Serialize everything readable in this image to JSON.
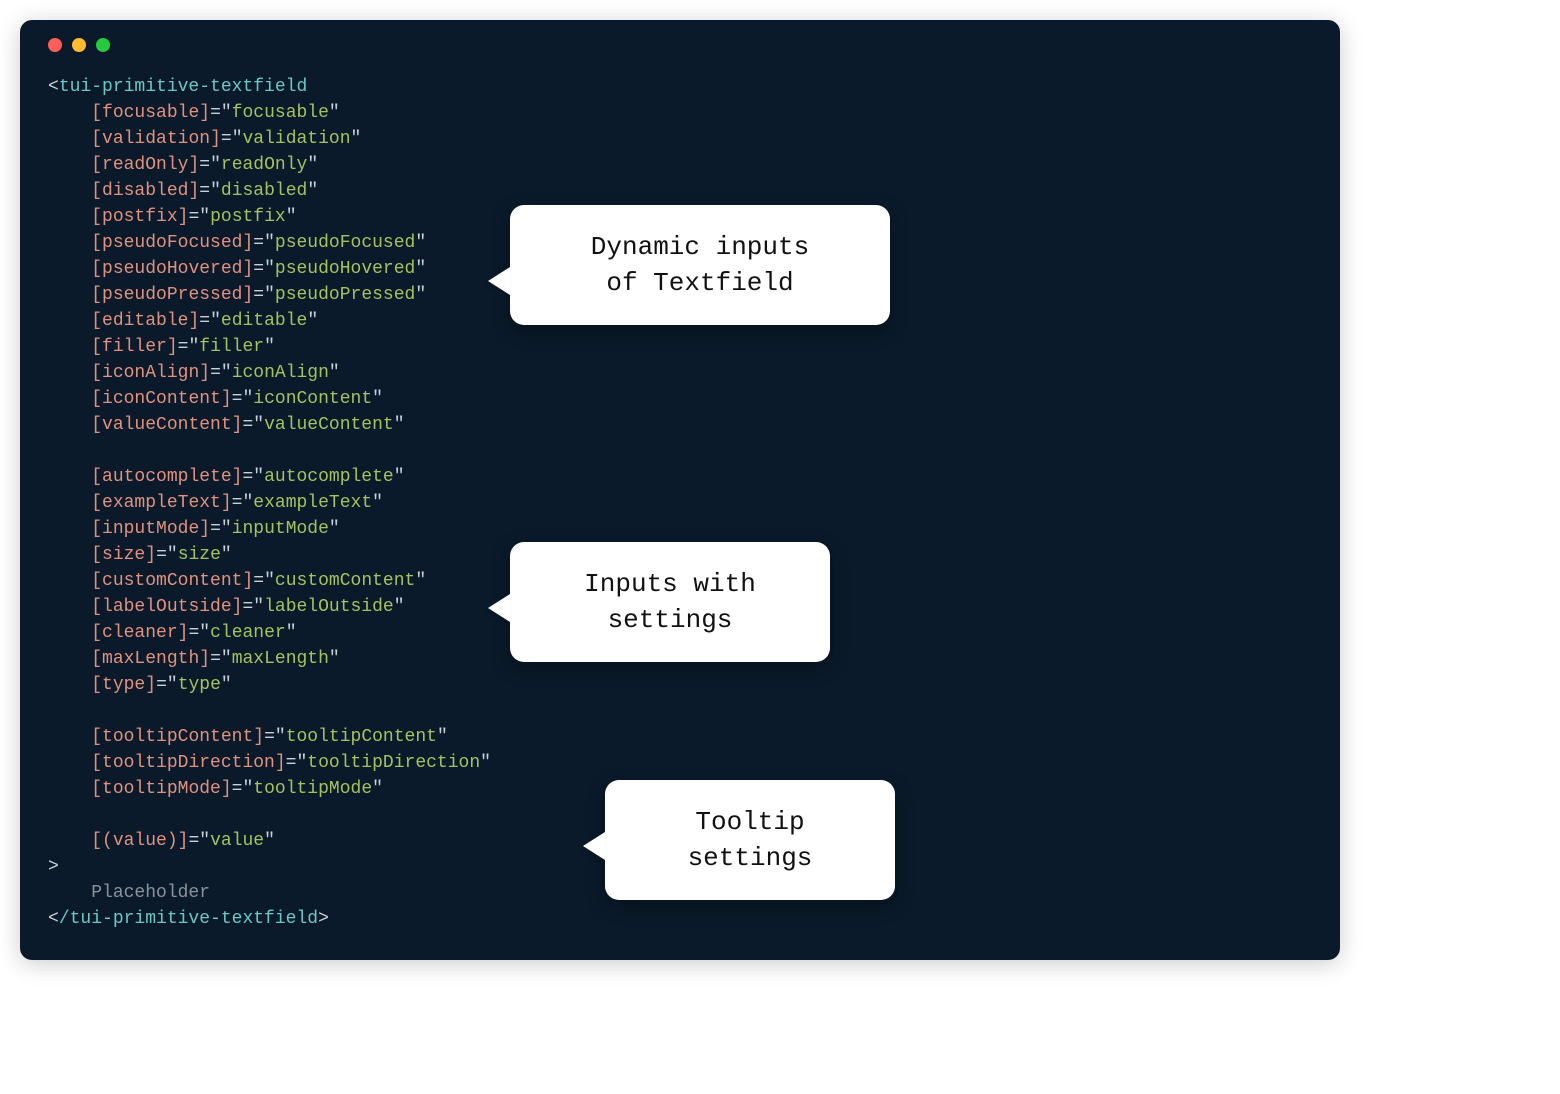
{
  "tag_open": "tui-primitive-textfield",
  "tag_close": "/tui-primitive-textfield",
  "placeholder_text": "Placeholder",
  "group1": [
    {
      "attr": "focusable",
      "val": "focusable"
    },
    {
      "attr": "validation",
      "val": "validation"
    },
    {
      "attr": "readOnly",
      "val": "readOnly"
    },
    {
      "attr": "disabled",
      "val": "disabled"
    },
    {
      "attr": "postfix",
      "val": "postfix"
    },
    {
      "attr": "pseudoFocused",
      "val": "pseudoFocused"
    },
    {
      "attr": "pseudoHovered",
      "val": "pseudoHovered"
    },
    {
      "attr": "pseudoPressed",
      "val": "pseudoPressed"
    },
    {
      "attr": "editable",
      "val": "editable"
    },
    {
      "attr": "filler",
      "val": "filler"
    },
    {
      "attr": "iconAlign",
      "val": "iconAlign"
    },
    {
      "attr": "iconContent",
      "val": "iconContent"
    },
    {
      "attr": "valueContent",
      "val": "valueContent"
    }
  ],
  "group2": [
    {
      "attr": "autocomplete",
      "val": "autocomplete"
    },
    {
      "attr": "exampleText",
      "val": "exampleText"
    },
    {
      "attr": "inputMode",
      "val": "inputMode"
    },
    {
      "attr": "size",
      "val": "size"
    },
    {
      "attr": "customContent",
      "val": "customContent"
    },
    {
      "attr": "labelOutside",
      "val": "labelOutside"
    },
    {
      "attr": "cleaner",
      "val": "cleaner"
    },
    {
      "attr": "maxLength",
      "val": "maxLength"
    },
    {
      "attr": "type",
      "val": "type"
    }
  ],
  "group3": [
    {
      "attr": "tooltipContent",
      "val": "tooltipContent"
    },
    {
      "attr": "tooltipDirection",
      "val": "tooltipDirection"
    },
    {
      "attr": "tooltipMode",
      "val": "tooltipMode"
    }
  ],
  "group4": [
    {
      "attr": "(value)",
      "val": "value"
    }
  ],
  "callouts": {
    "c1": "Dynamic inputs\nof Textfield",
    "c2": "Inputs with\nsettings",
    "c3": "Tooltip\nsettings"
  }
}
